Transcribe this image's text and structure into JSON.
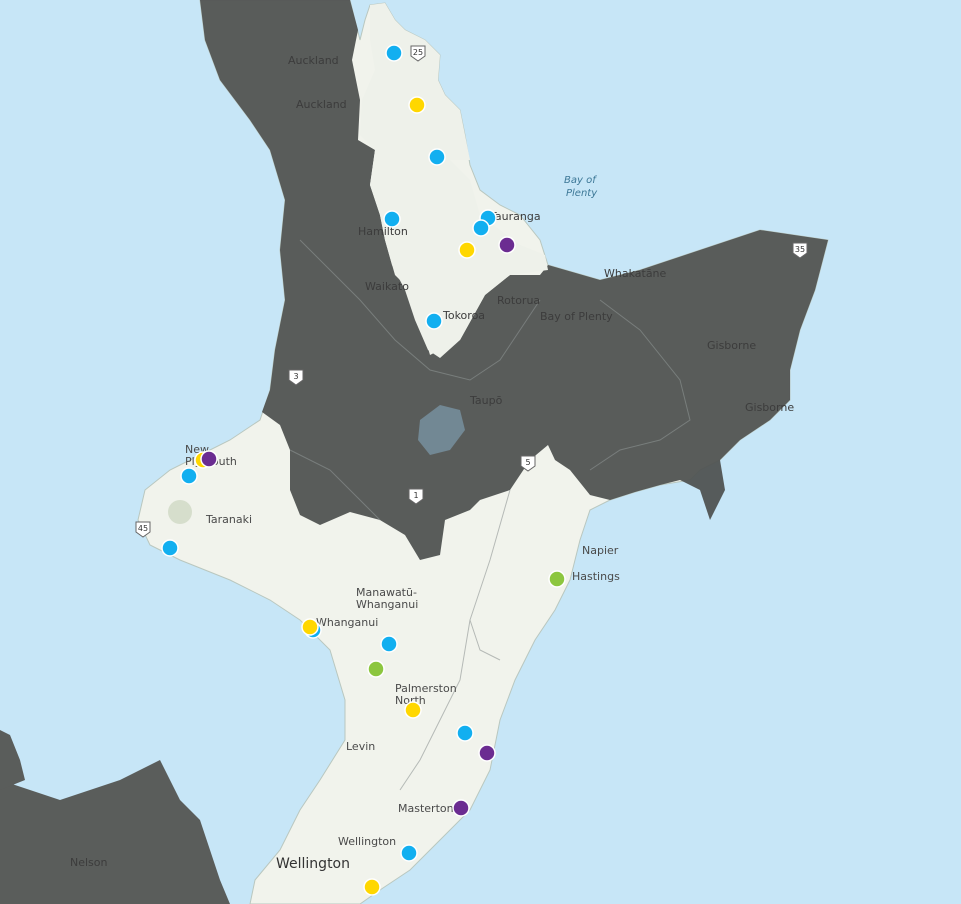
{
  "map": {
    "place_labels": [
      {
        "key": "auckland_city",
        "text": "Auckland"
      },
      {
        "key": "auckland_region",
        "text": "Auckland"
      },
      {
        "key": "hamilton",
        "text": "Hamilton"
      },
      {
        "key": "waikato",
        "text": "Waikato"
      },
      {
        "key": "tauranga",
        "text": "Tauranga"
      },
      {
        "key": "bay_of_plenty_sea",
        "text": "Bay of\nPlenty"
      },
      {
        "key": "whakatane",
        "text": "Whakatāne"
      },
      {
        "key": "rotorua",
        "text": "Rotorua"
      },
      {
        "key": "bay_of_plenty_region",
        "text": "Bay of Plenty"
      },
      {
        "key": "tokoroa",
        "text": "Tokoroa"
      },
      {
        "key": "gisborne_region",
        "text": "Gisborne"
      },
      {
        "key": "gisborne_city",
        "text": "Gisborne"
      },
      {
        "key": "taupo",
        "text": "Taupō"
      },
      {
        "key": "new_plymouth",
        "text": "New\nPlymouth"
      },
      {
        "key": "taranaki",
        "text": "Taranaki"
      },
      {
        "key": "napier",
        "text": "Napier"
      },
      {
        "key": "hastings",
        "text": "Hastings"
      },
      {
        "key": "manawatu",
        "text": "Manawatū-\nWhanganui"
      },
      {
        "key": "whanganui",
        "text": "Whanganui"
      },
      {
        "key": "palmerston",
        "text": "Palmerston\nNorth"
      },
      {
        "key": "levin",
        "text": "Levin"
      },
      {
        "key": "masterton",
        "text": "Masterton"
      },
      {
        "key": "wellington_region",
        "text": "Wellington"
      },
      {
        "key": "wellington_city",
        "text": "Wellington"
      },
      {
        "key": "nelson",
        "text": "Nelson"
      }
    ],
    "highway_shields": [
      "25",
      "35",
      "3",
      "5",
      "1",
      "45"
    ],
    "marker_colors": {
      "blue": "#12aff0",
      "yellow": "#ffd700",
      "purple": "#6b2c91",
      "green": "#8cc63f"
    },
    "shaded_region_color": "#4f4f4f",
    "land_color": "#f1f3ec",
    "water_color": "#c7e6f7"
  }
}
